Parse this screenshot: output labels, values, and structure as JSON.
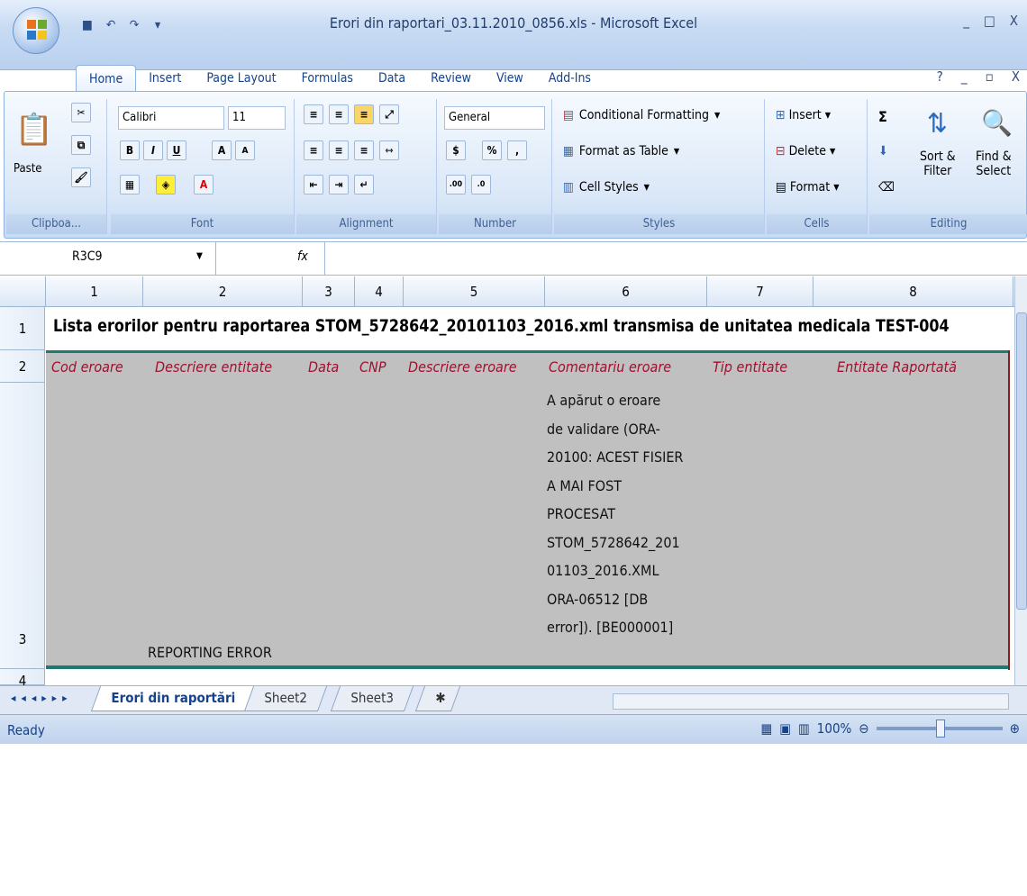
{
  "window": {
    "title": "Erori din raportari_03.11.2010_0856.xls - Microsoft Excel"
  },
  "quick_access": [
    "save-icon",
    "undo-icon",
    "redo-icon",
    "customize-icon"
  ],
  "tabs": [
    "Home",
    "Insert",
    "Page Layout",
    "Formulas",
    "Data",
    "Review",
    "View",
    "Add-Ins"
  ],
  "ribbon": {
    "clipboard": {
      "paste": "Paste",
      "label": "Clipboa..."
    },
    "font": {
      "name": "Calibri",
      "size": "11",
      "label": "Font",
      "bold": "B",
      "italic": "I",
      "underline": "U",
      "grow": "A",
      "shrink": "A"
    },
    "alignment": {
      "label": "Alignment"
    },
    "number": {
      "format": "General",
      "currency": "$",
      "percent": "%",
      "comma": ",",
      "inc": ".00",
      "dec": ".0",
      "label": "Number"
    },
    "styles": {
      "conditional": "Conditional Formatting",
      "table": "Format as Table",
      "cell": "Cell Styles",
      "label": "Styles"
    },
    "cells": {
      "insert": "Insert",
      "delete": "Delete",
      "format": "Format",
      "label": "Cells"
    },
    "editing": {
      "sum": "Σ",
      "sort": "Sort &\nFilter",
      "find": "Find &\nSelect",
      "label": "Editing"
    }
  },
  "formula_bar": {
    "name_box": "R3C9",
    "fx": "fx",
    "formula": ""
  },
  "columns": [
    "1",
    "2",
    "3",
    "4",
    "5",
    "6",
    "7",
    "8"
  ],
  "rows": [
    "1",
    "2",
    "3",
    "4"
  ],
  "cells": {
    "title": "Lista erorilor pentru raportarea STOM_5728642_20101103_2016.xml transmisa de unitatea medicala TEST-004",
    "headers": [
      "Cod eroare",
      "Descriere entitate",
      "Data",
      "CNP",
      "Descriere eroare",
      "Comentariu eroare",
      "Tip entitate",
      "Entitate Raportată"
    ],
    "comment_lines": [
      "A apărut o eroare",
      "de validare (ORA-",
      "20100: ACEST FISIER",
      "A MAI FOST",
      "PROCESAT",
      "STOM_5728642_201",
      "01103_2016.XML",
      "ORA-06512 [DB",
      "error]). [BE000001]"
    ],
    "reporting_error": "REPORTING ERROR"
  },
  "sheets": [
    "Erori din raportări",
    "Sheet2",
    "Sheet3"
  ],
  "status": {
    "ready": "Ready",
    "zoom": "100%"
  }
}
